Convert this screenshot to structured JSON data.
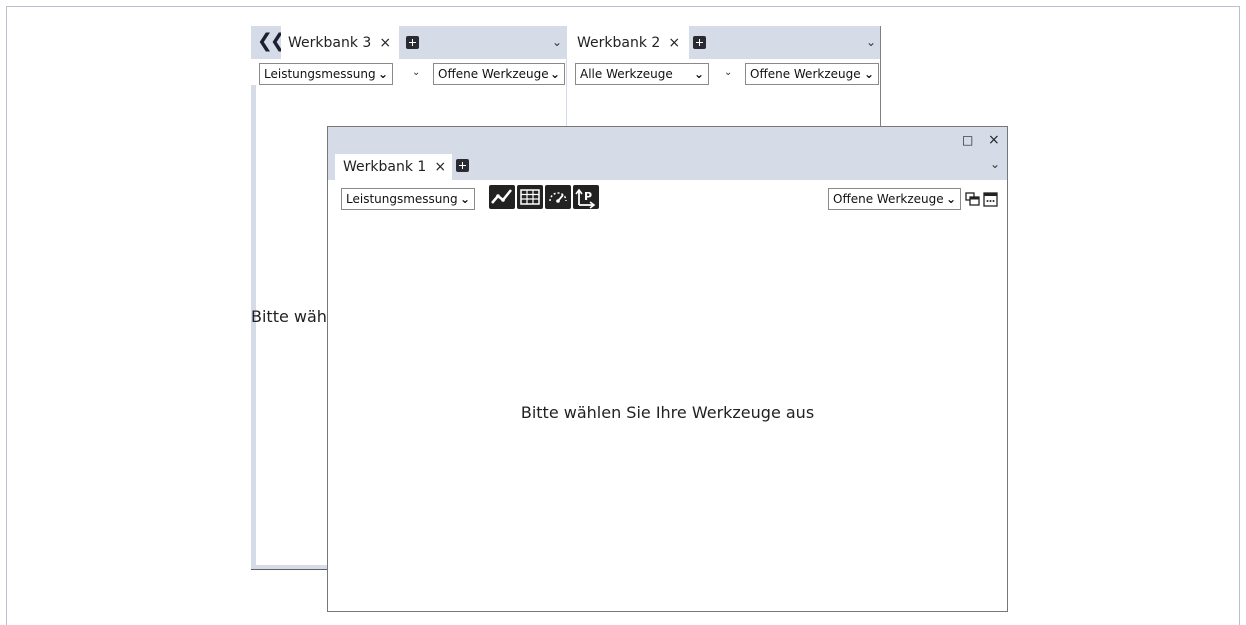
{
  "back_window": {
    "pane_a": {
      "tab_label": "Werkbank 3",
      "tab_close": "×",
      "select_left": "Leistungsmessung",
      "select_right": "Offene Werkzeuge",
      "body_text": "Bitte wähl"
    },
    "pane_b": {
      "tab_label": "Werkbank 2",
      "tab_close": "×",
      "select_left": "Alle Werkzeuge",
      "select_right": "Offene Werkzeuge"
    }
  },
  "front_window": {
    "tab_label": "Werkbank 1",
    "tab_close": "×",
    "select_left": "Leistungsmessung",
    "select_right": "Offene Werkzeuge",
    "maximize_glyph": "□",
    "close_glyph": "×",
    "message": "Bitte wählen Sie Ihre Werkzeuge aus",
    "tool_icons": [
      "line-chart-icon",
      "table-icon",
      "gauge-icon",
      "pivot-icon"
    ]
  }
}
